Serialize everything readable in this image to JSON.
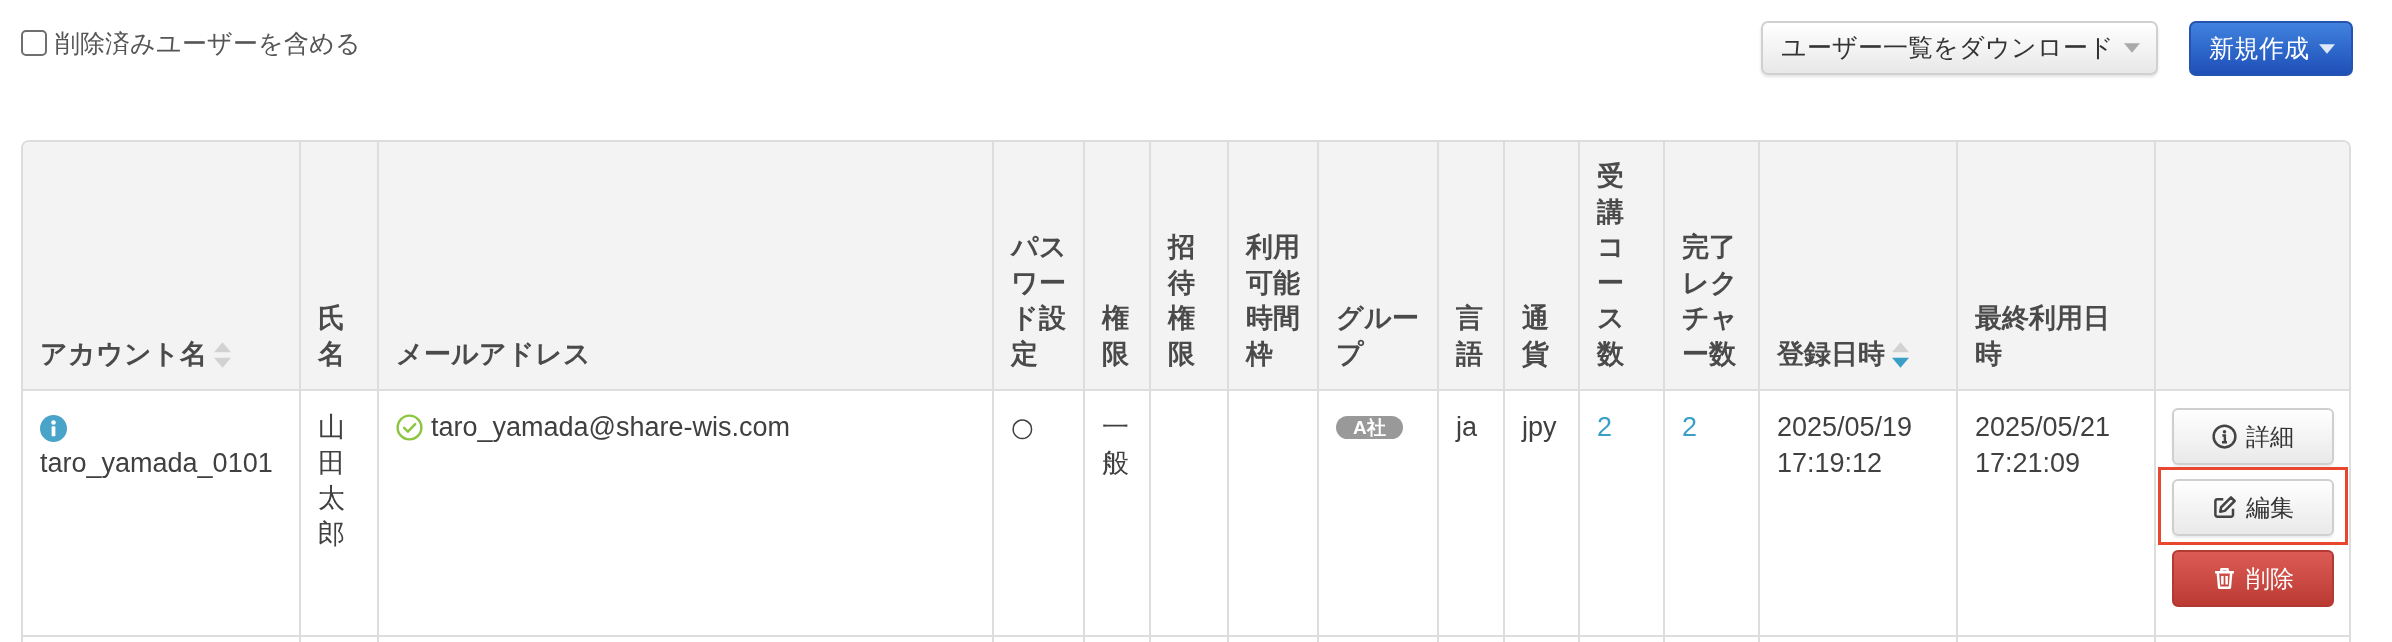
{
  "filters": {
    "include_deleted": {
      "label": "削除済みユーザーを含める",
      "checked": false
    }
  },
  "toolbar": {
    "download_button": {
      "label": "ユーザー一覧をダウンロード"
    },
    "new_button": {
      "label": "新規作成"
    }
  },
  "table": {
    "columns": [
      {
        "label": "アカウント名",
        "sortable": true,
        "sorted": false
      },
      {
        "label": "氏名"
      },
      {
        "label": "メールアドレス"
      },
      {
        "label": "パスワード設定"
      },
      {
        "label": "権限"
      },
      {
        "label": "招待権限"
      },
      {
        "label": "利用可能時間枠"
      },
      {
        "label": "グループ"
      },
      {
        "label": "言語"
      },
      {
        "label": "通貨"
      },
      {
        "label": "受講コース数"
      },
      {
        "label": "完了レクチャー数"
      },
      {
        "label": "登録日時",
        "sortable": true,
        "sorted": true
      },
      {
        "label": "最終利用日時"
      }
    ],
    "rows": [
      {
        "account_name": "taro_yamada_0101",
        "full_name": "山田太郎",
        "email": "taro_yamada@share-wis.com",
        "email_verified": true,
        "password_set": "○",
        "role": "一般",
        "group": "A社",
        "language": "ja",
        "currency": "jpy",
        "courses": "2",
        "completed_lectures": "2",
        "registered_at": "2025/05/19 17:19:12",
        "last_used_at": "2025/05/21 17:21:09",
        "actions": [
          {
            "kind": "detail",
            "label": "詳細",
            "highlighted": false
          },
          {
            "kind": "edit",
            "label": "編集",
            "highlighted": true
          },
          {
            "kind": "delete",
            "label": "削除",
            "highlighted": false
          }
        ]
      }
    ]
  }
}
